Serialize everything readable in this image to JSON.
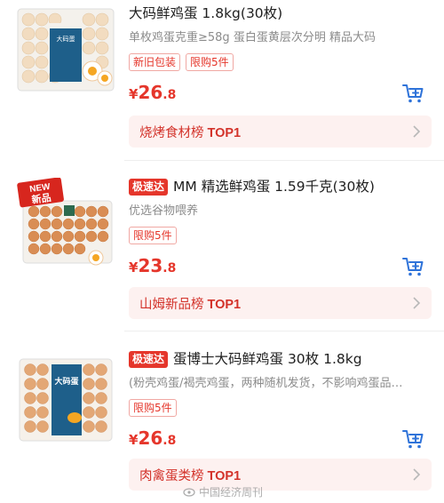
{
  "products": [
    {
      "title": "大码鲜鸡蛋 1.8kg(30枚)",
      "express": "",
      "subtitle": "单枚鸡蛋克重≥58g 蛋白蛋黄层次分明 精品大码",
      "tags": [
        "新旧包装",
        "限购5件"
      ],
      "price_currency": "¥",
      "price_int": "26",
      "price_dec": ".8",
      "rank_name": "烧烤食材榜",
      "rank_top": "TOP1",
      "image_badge": "",
      "image_label": "大码蛋"
    },
    {
      "title": "MM 精选鲜鸡蛋 1.59千克(30枚)",
      "express": "极速达",
      "subtitle": "优选谷物喂养",
      "tags": [
        "限购5件"
      ],
      "price_currency": "¥",
      "price_int": "23",
      "price_dec": ".8",
      "rank_name": "山姆新品榜",
      "rank_top": "TOP1",
      "image_badge_en": "NEW",
      "image_badge_cn": "新品",
      "image_label": ""
    },
    {
      "title": "蛋博士大码鲜鸡蛋 30枚 1.8kg",
      "express": "极速达",
      "subtitle": "(粉壳鸡蛋/褐壳鸡蛋，两种随机发货，不影响鸡蛋品…",
      "tags": [
        "限购5件"
      ],
      "price_currency": "¥",
      "price_int": "26",
      "price_dec": ".8",
      "rank_name": "肉禽蛋类榜",
      "rank_top": "TOP1",
      "image_badge": "",
      "image_label": "大码蛋"
    }
  ],
  "watermark": "中国经济周刊",
  "colors": {
    "accent": "#e5362b",
    "rank_bg": "#fdf1f0",
    "cart": "#2f73d9"
  }
}
